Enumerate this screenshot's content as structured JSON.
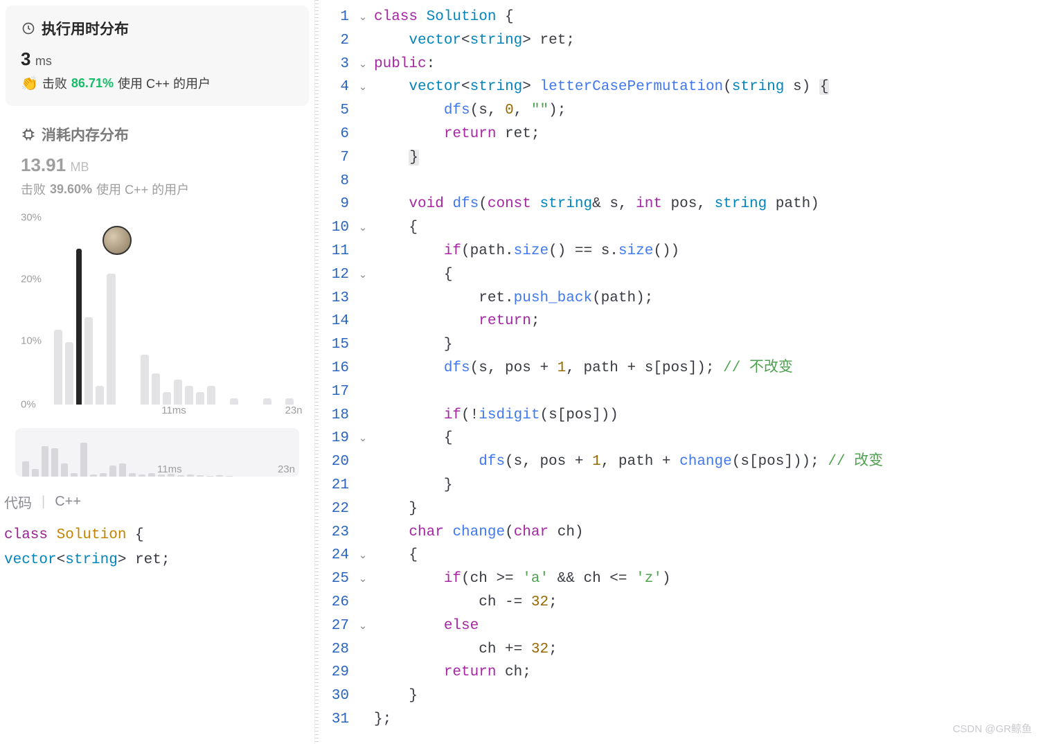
{
  "left": {
    "runtime": {
      "title": "执行用时分布",
      "value": "3",
      "unit": "ms",
      "beat_label": "击败",
      "beat_pct": "86.71%",
      "beat_suffix": "使用 C++ 的用户"
    },
    "memory": {
      "title": "消耗内存分布",
      "value": "13.91",
      "unit": "MB",
      "beat_label": "击败",
      "beat_pct": "39.60%",
      "beat_suffix": "使用 C++ 的用户"
    },
    "chart": {
      "y_ticks": [
        "30%",
        "20%",
        "10%",
        "0%"
      ],
      "x_ticks": [
        "11ms",
        "23n"
      ],
      "you_bin_index": 2,
      "bins_pct": [
        12,
        10,
        25,
        14,
        3,
        21,
        0,
        0,
        8,
        5,
        2,
        4,
        3,
        2,
        3,
        0,
        1,
        0,
        0,
        1,
        0,
        1
      ]
    },
    "mini": {
      "bins_pct": [
        40,
        20,
        80,
        75,
        35,
        10,
        90,
        5,
        10,
        30,
        35,
        10,
        5,
        10,
        5,
        8,
        4,
        6,
        3,
        2,
        3,
        2
      ],
      "x_ticks": [
        "11ms",
        "23n"
      ]
    },
    "lang_row": {
      "code_label": "代码",
      "language": "C++"
    },
    "snippet": {
      "l1_kw": "class",
      "l1_cls": "Solution",
      "l1_rest": " {",
      "l2_typ": "vector",
      "l2_inner": "string",
      "l2_rest": " ret;"
    }
  },
  "code": {
    "lines": [
      {
        "n": 1,
        "fold": "⌄"
      },
      {
        "n": 2,
        "fold": ""
      },
      {
        "n": 3,
        "fold": "⌄"
      },
      {
        "n": 4,
        "fold": "⌄"
      },
      {
        "n": 5,
        "fold": ""
      },
      {
        "n": 6,
        "fold": ""
      },
      {
        "n": 7,
        "fold": ""
      },
      {
        "n": 8,
        "fold": ""
      },
      {
        "n": 9,
        "fold": ""
      },
      {
        "n": 10,
        "fold": "⌄"
      },
      {
        "n": 11,
        "fold": ""
      },
      {
        "n": 12,
        "fold": "⌄"
      },
      {
        "n": 13,
        "fold": ""
      },
      {
        "n": 14,
        "fold": ""
      },
      {
        "n": 15,
        "fold": ""
      },
      {
        "n": 16,
        "fold": ""
      },
      {
        "n": 17,
        "fold": ""
      },
      {
        "n": 18,
        "fold": ""
      },
      {
        "n": 19,
        "fold": "⌄"
      },
      {
        "n": 20,
        "fold": ""
      },
      {
        "n": 21,
        "fold": ""
      },
      {
        "n": 22,
        "fold": ""
      },
      {
        "n": 23,
        "fold": ""
      },
      {
        "n": 24,
        "fold": "⌄"
      },
      {
        "n": 25,
        "fold": "⌄"
      },
      {
        "n": 26,
        "fold": ""
      },
      {
        "n": 27,
        "fold": "⌄"
      },
      {
        "n": 28,
        "fold": ""
      },
      {
        "n": 29,
        "fold": ""
      },
      {
        "n": 30,
        "fold": ""
      },
      {
        "n": 31,
        "fold": ""
      }
    ],
    "tokens": {
      "class": "class",
      "Solution": "Solution",
      "vector": "vector",
      "string": "string",
      "ret": "ret",
      "public": "public",
      "letterCasePermutation": "letterCasePermutation",
      "s": "s",
      "dfs": "dfs",
      "zero": "0",
      "empty": "\"\"",
      "return": "return",
      "void": "void",
      "const": "const",
      "int": "int",
      "pos": "pos",
      "path": "path",
      "if": "if",
      "size": "size",
      "push_back": "push_back",
      "plus1": "1",
      "cmt_nochange": "// 不改变",
      "isdigit": "isdigit",
      "change": "change",
      "cmt_change": "// 改变",
      "char": "char",
      "ch": "ch",
      "a": "'a'",
      "z": "'z'",
      "n32": "32",
      "else": "else"
    }
  },
  "chart_data": {
    "type": "bar",
    "title": "执行用时分布",
    "xlabel": "ms",
    "ylabel": "percent",
    "ylim": [
      0,
      30
    ],
    "categories_ms": [
      1,
      2,
      3,
      4,
      5,
      6,
      7,
      8,
      9,
      10,
      11,
      12,
      13,
      14,
      15,
      16,
      17,
      18,
      19,
      20,
      21,
      22
    ],
    "values_pct": [
      12,
      10,
      25,
      14,
      3,
      21,
      0,
      0,
      8,
      5,
      2,
      4,
      3,
      2,
      3,
      0,
      1,
      0,
      0,
      1,
      0,
      1
    ],
    "user_value_ms": 3,
    "user_percentile_beats": 86.71,
    "x_tick_labels": [
      "11ms",
      "23n"
    ]
  },
  "watermark": "CSDN @GR鲸鱼"
}
